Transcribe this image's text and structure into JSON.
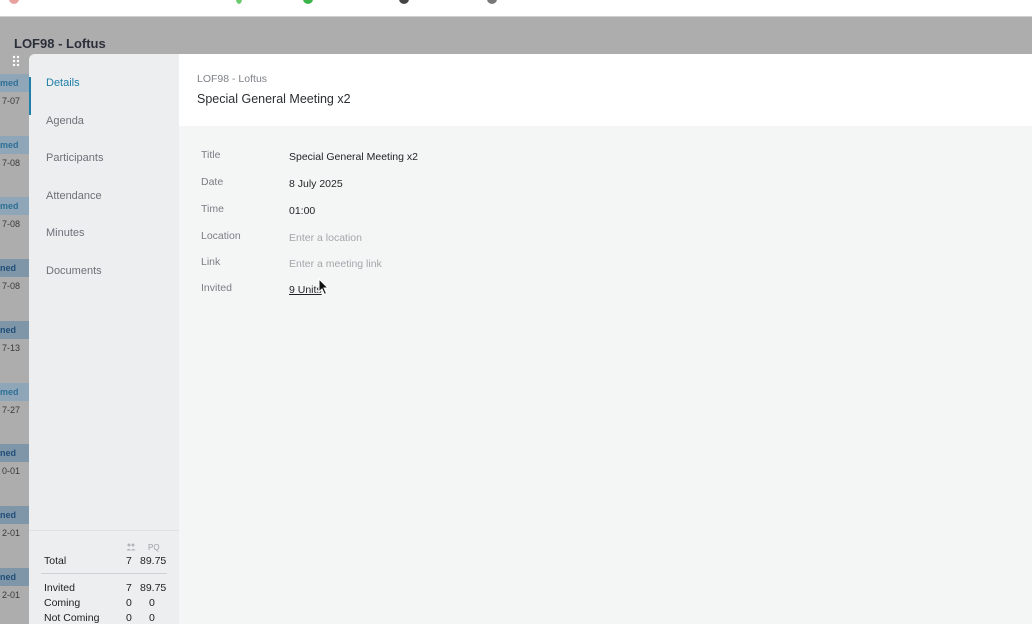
{
  "background": {
    "title": "LOF98 - Loftus",
    "rows": [
      {
        "badge": "med",
        "date": "7-07",
        "dark": false
      },
      {
        "badge": "med",
        "date": "7-08",
        "dark": false
      },
      {
        "badge": "med",
        "date": "7-08",
        "dark": false
      },
      {
        "badge": "ned",
        "date": "7-08",
        "dark": true
      },
      {
        "badge": "ned",
        "date": "7-13",
        "dark": true
      },
      {
        "badge": "med",
        "date": "7-27",
        "dark": false
      },
      {
        "badge": "ned",
        "date": "0-01",
        "dark": true
      },
      {
        "badge": "ned",
        "date": "2-01",
        "dark": true
      },
      {
        "badge": "ned",
        "date": "2-01",
        "dark": true
      }
    ]
  },
  "sidebar": {
    "items": [
      {
        "label": "Details",
        "active": true
      },
      {
        "label": "Agenda",
        "active": false
      },
      {
        "label": "Participants",
        "active": false
      },
      {
        "label": "Attendance",
        "active": false
      },
      {
        "label": "Minutes",
        "active": false
      },
      {
        "label": "Documents",
        "active": false
      }
    ]
  },
  "summary": {
    "pq_header": "PQ",
    "people_icon": "people-icon",
    "total": {
      "label": "Total",
      "count": "7",
      "pq": "89.75"
    },
    "invited": {
      "label": "Invited",
      "count": "7",
      "pq": "89.75"
    },
    "coming": {
      "label": "Coming",
      "count": "0",
      "pq": "0"
    },
    "not_coming": {
      "label": "Not Coming",
      "count": "0",
      "pq": "0"
    }
  },
  "header": {
    "breadcrumb": "LOF98 - Loftus",
    "title": "Special General Meeting x2"
  },
  "fields": {
    "title": {
      "label": "Title",
      "value": "Special General Meeting x2"
    },
    "date": {
      "label": "Date",
      "value": "8 July 2025"
    },
    "time": {
      "label": "Time",
      "value": "01:00"
    },
    "location": {
      "label": "Location",
      "placeholder": "Enter a location"
    },
    "link": {
      "label": "Link",
      "placeholder": "Enter a meeting link"
    },
    "invited": {
      "label": "Invited",
      "value": "9 Units"
    }
  },
  "colors": {
    "accent": "#1f7fa8",
    "badge_text": "#2f6f96"
  }
}
